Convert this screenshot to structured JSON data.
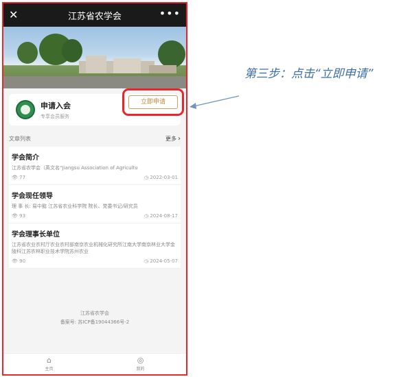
{
  "app": {
    "title": "江苏省农学会"
  },
  "apply": {
    "title": "申请入会",
    "subtitle": "专享会员服务",
    "button_label": "立即申请"
  },
  "list": {
    "header": "文章列表",
    "more_label": "更多"
  },
  "articles": [
    {
      "title": "学会简介",
      "desc": "江苏省农学会（英文名“Jiangsu Association of Agricultu",
      "views": "77",
      "date": "2022-03-01"
    },
    {
      "title": "学会现任领导",
      "desc": "理  事  长:  易中懿  江苏省农业科学院  院长、党委书记/研究员",
      "views": "93",
      "date": "2024-08-17"
    },
    {
      "title": "学会理事长单位",
      "desc": "江苏省农业农村厅农业农村部南京农业机械化研究所江南大学南京林业大学金陵科江苏农林职业技术学院苏州农业",
      "views": "90",
      "date": "2024-05-07"
    }
  ],
  "footer": {
    "org": "江苏省农学会",
    "icp": "备案号: 苏ICP备19044366号-2"
  },
  "tabs": [
    {
      "label": "主页",
      "icon": "home-icon"
    },
    {
      "label": "我的",
      "icon": "user-icon"
    }
  ],
  "annotation": {
    "text": "第三步：点击“立即申请”"
  },
  "colors": {
    "highlight": "#e8262c",
    "accent": "#c08a3a",
    "annotation": "#3f6fa8"
  }
}
